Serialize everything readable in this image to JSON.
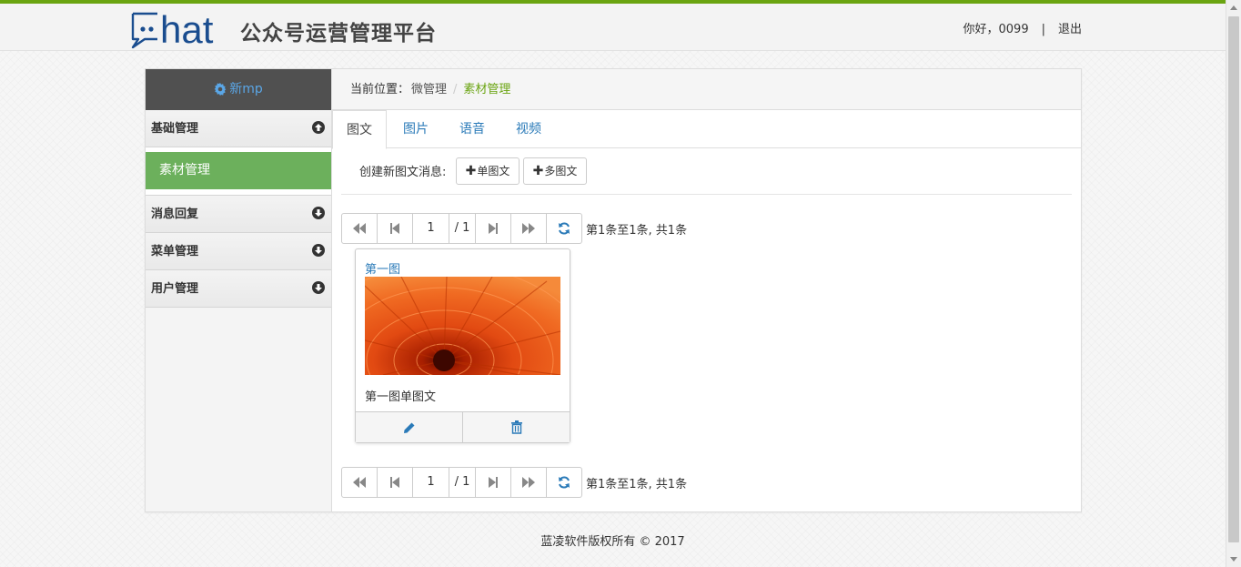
{
  "header": {
    "logo_text": "hat",
    "site_title": "公众号运营管理平台",
    "greeting": "你好，0099",
    "separator": "|",
    "logout_label": "退出"
  },
  "sidebar": {
    "title": "新mp",
    "groups": [
      {
        "label": "基础管理",
        "icon": "arrow-up-circle-icon",
        "expanded": true,
        "items": [
          {
            "label": "素材管理",
            "active": true
          }
        ]
      },
      {
        "label": "消息回复",
        "icon": "arrow-down-circle-icon"
      },
      {
        "label": "菜单管理",
        "icon": "arrow-down-circle-icon"
      },
      {
        "label": "用户管理",
        "icon": "arrow-down-circle-icon"
      }
    ]
  },
  "breadcrumb": {
    "label": "当前位置：",
    "items": [
      "微管理",
      "素材管理"
    ],
    "separator": "/"
  },
  "tabs": [
    {
      "label": "图文",
      "active": true
    },
    {
      "label": "图片"
    },
    {
      "label": "语音"
    },
    {
      "label": "视频"
    }
  ],
  "create": {
    "label": "创建新图文消息:",
    "single_label": "单图文",
    "multi_label": "多图文"
  },
  "pager": {
    "page": "1",
    "total_pages": "/ 1",
    "info": "第1条至1条, 共1条"
  },
  "card": {
    "title": "第一图",
    "description": "第一图单图文",
    "edit_icon": "pencil-icon",
    "delete_icon": "trash-icon"
  },
  "footer": {
    "copyright": "蓝凌软件版权所有 © 2017"
  },
  "colors": {
    "accent_green": "#6aa411",
    "active_menu": "#6cb05c",
    "link_blue": "#2a7ab8",
    "sidebar_head": "#505050"
  }
}
